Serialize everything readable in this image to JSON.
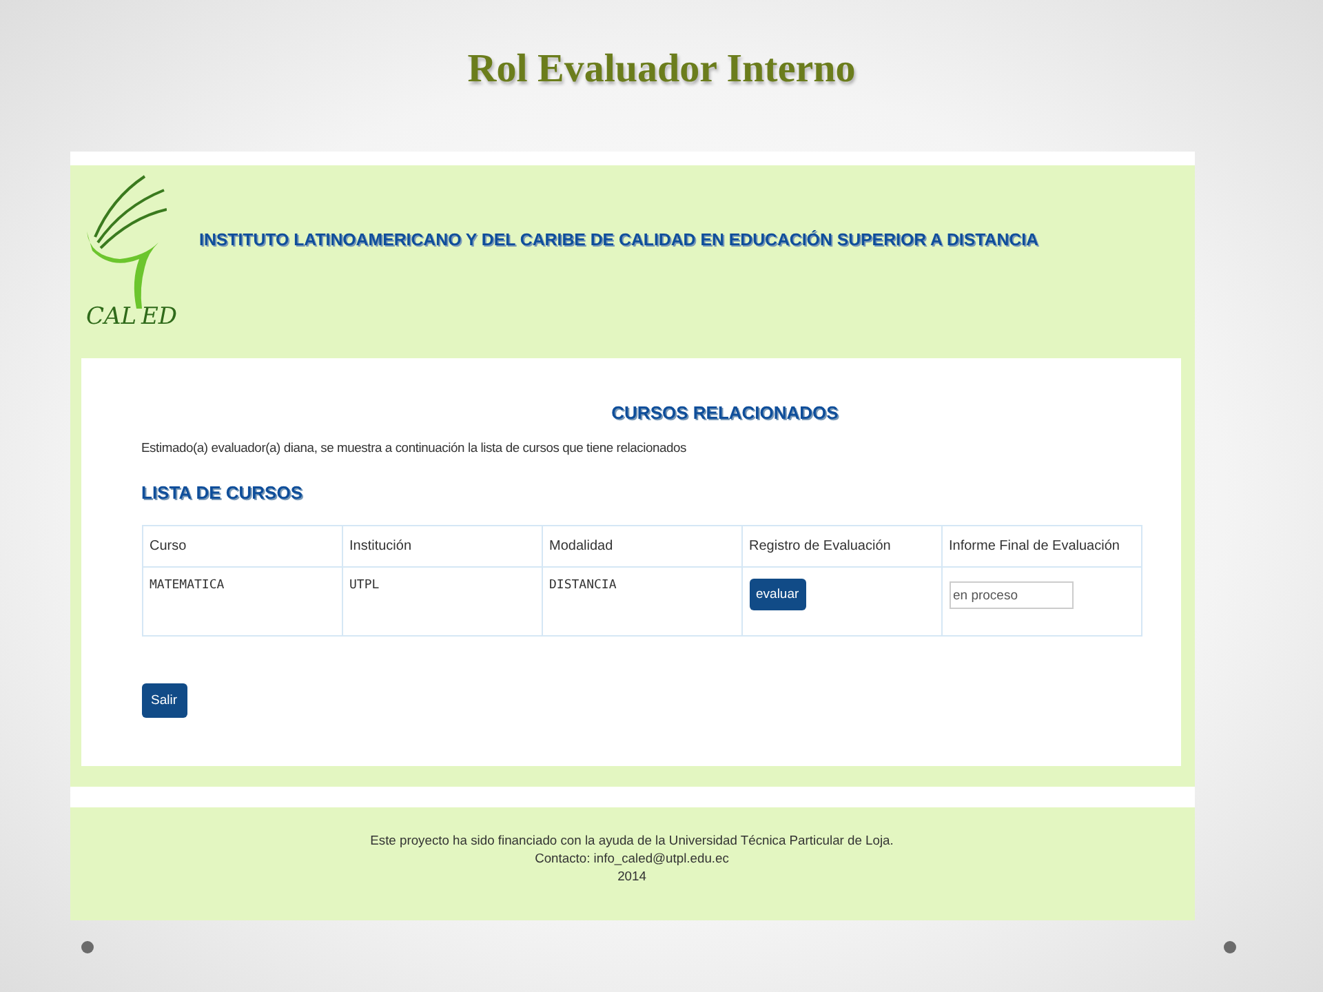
{
  "slide_title": "Rol Evaluador  Interno",
  "header": {
    "logo_left": "CAL",
    "logo_right": "ED",
    "institute": "INSTITUTO LATINOAMERICANO Y DEL CARIBE DE CALIDAD EN EDUCACIÓN SUPERIOR A DISTANCIA"
  },
  "content": {
    "heading": "CURSOS RELACIONADOS",
    "intro": "Estimado(a) evaluador(a) diana, se muestra a continuación la lista de cursos que tiene relacionados",
    "list_heading": "LISTA DE CURSOS",
    "table": {
      "columns": [
        "Curso",
        "Institución",
        "Modalidad",
        "Registro de Evaluación",
        "Informe Final de Evaluación"
      ],
      "rows": [
        {
          "curso": "MATEMATICA",
          "institucion": "UTPL",
          "modalidad": "DISTANCIA",
          "button": "evaluar",
          "informe": "en proceso"
        }
      ]
    },
    "exit_button": "Salir"
  },
  "footer": [
    "Este proyecto ha sido financiado con la ayuda de la Universidad Técnica Particular de Loja.",
    "Contacto: info_caled@utpl.edu.ec",
    "2014"
  ]
}
